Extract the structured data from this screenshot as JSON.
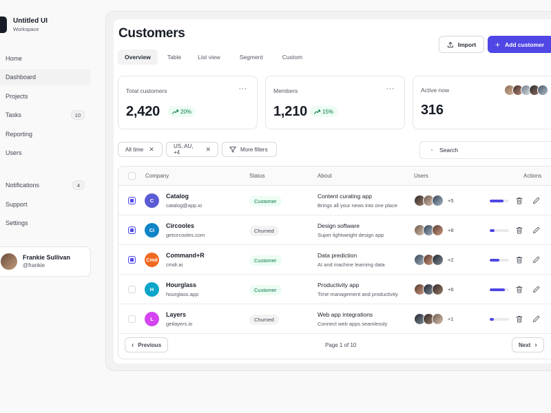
{
  "brand": {
    "name": "Untitled UI",
    "subtitle": "Workspace"
  },
  "nav": {
    "primary": [
      {
        "label": "Home"
      },
      {
        "label": "Dashboard",
        "active": true
      },
      {
        "label": "Projects"
      },
      {
        "label": "Tasks",
        "badge": "10"
      },
      {
        "label": "Reporting"
      },
      {
        "label": "Users"
      }
    ],
    "secondary": [
      {
        "label": "Notifications",
        "badge": "4"
      },
      {
        "label": "Support"
      },
      {
        "label": "Settings"
      }
    ]
  },
  "user": {
    "name": "Frankie Sullivan",
    "handle": "@frankie"
  },
  "header": {
    "title": "Customers",
    "tabs": [
      "Overview",
      "Table",
      "List view",
      "Segment",
      "Custom"
    ],
    "active_tab": "Overview",
    "import_label": "Import",
    "add_label": "Add customer"
  },
  "stats": [
    {
      "label": "Total customers",
      "value": "2,420",
      "delta": "20%",
      "menu": "···"
    },
    {
      "label": "Members",
      "value": "1,210",
      "delta": "15%",
      "menu": "···"
    },
    {
      "label": "Active now",
      "value": "316"
    }
  ],
  "filters": {
    "chips": [
      "All time",
      "US, AU, +4"
    ],
    "more_label": "More filters",
    "search_placeholder": "Search"
  },
  "table": {
    "columns": {
      "company": "Company",
      "status": "Status",
      "about": "About",
      "users": "Users",
      "actions": "Actions"
    },
    "rows": [
      {
        "initials": "C",
        "logo_color": "#5b5bd6",
        "name": "Catalog",
        "domain": "catalog@app.io",
        "status": "Customer",
        "about_title": "Content curating app",
        "about_sub": "Brings all your news into one place",
        "more_users": "+5",
        "progress": 0.7,
        "checked": true
      },
      {
        "initials": "Ci",
        "logo_color": "#0e84c8",
        "name": "Circooles",
        "domain": "getcircooles.com",
        "status": "Churned",
        "about_title": "Design software",
        "about_sub": "Super lightweight design app",
        "more_users": "+8",
        "progress": 0.25,
        "checked": true
      },
      {
        "initials": "Cmd",
        "logo_color": "#ef6820",
        "name": "Command+R",
        "domain": "cmdr.ai",
        "status": "Customer",
        "about_title": "Data prediction",
        "about_sub": "AI and machine learning data",
        "more_users": "+2",
        "progress": 0.5,
        "checked": true
      },
      {
        "initials": "H",
        "logo_color": "#0ba5c9",
        "name": "Hourglass",
        "domain": "hourglass.app",
        "status": "Customer",
        "about_title": "Productivity app",
        "about_sub": "Time management and productivity",
        "more_users": "+6",
        "progress": 0.8,
        "checked": false
      },
      {
        "initials": "L",
        "logo_color": "#d444f1",
        "name": "Layers",
        "domain": "getlayers.io",
        "status": "Churned",
        "about_title": "Web app integrations",
        "about_sub": "Connect web apps seamlessly",
        "more_users": "+1",
        "progress": 0.2,
        "checked": false
      }
    ]
  },
  "pagination": {
    "prev_label": "Previous",
    "next_label": "Next",
    "info": "Page 1 of 10"
  },
  "colors": {
    "accent": "#4f46e5",
    "success_bg": "#ecfdf3",
    "success_text": "#067647"
  }
}
